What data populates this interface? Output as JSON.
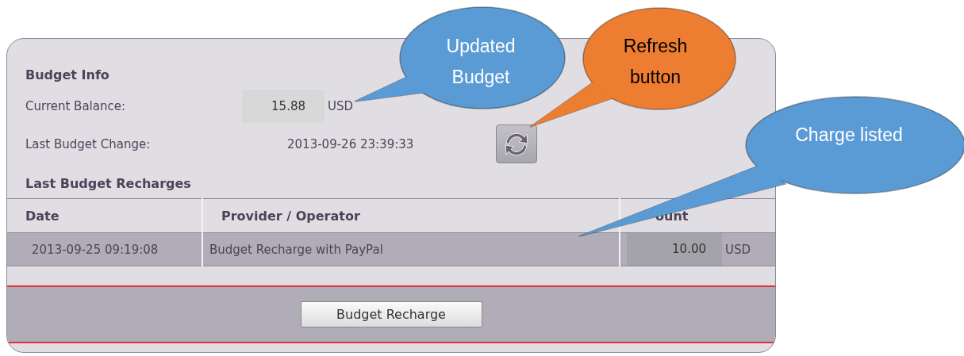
{
  "budget_info": {
    "heading": "Budget Info",
    "current_balance": {
      "label": "Current Balance:",
      "value": "15.88",
      "unit": "USD"
    },
    "last_change": {
      "label": "Last Budget Change:",
      "value": "2013-09-26 23:39:33"
    }
  },
  "recharges": {
    "heading": "Last Budget Recharges",
    "columns": [
      "Date",
      "Provider / Operator",
      "ount"
    ],
    "rows": [
      {
        "date": "2013-09-25 09:19:08",
        "provider": "Budget Recharge with PayPal",
        "amount": "10.00",
        "unit": "USD",
        "selected": true
      }
    ]
  },
  "recharge_button": "Budget Recharge",
  "callouts": [
    {
      "lines": [
        "Updated",
        "Budget"
      ],
      "color": "#5b9bd5"
    },
    {
      "lines": [
        "Refresh",
        "button"
      ],
      "color": "#ed7d31"
    },
    {
      "lines": [
        "Charge listed"
      ],
      "color": "#5b9bd5"
    }
  ]
}
